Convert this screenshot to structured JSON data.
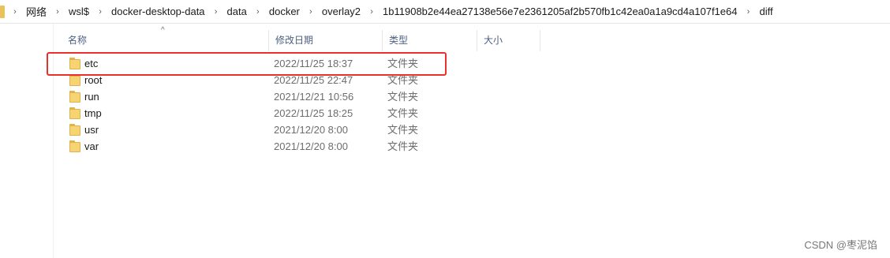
{
  "breadcrumb": {
    "items": [
      "网络",
      "wsl$",
      "docker-desktop-data",
      "data",
      "docker",
      "overlay2",
      "1b11908b2e44ea27138e56e7e2361205af2b570fb1c42ea0a1a9cd4a107f1e64",
      "diff"
    ],
    "separator": "›"
  },
  "columns": {
    "name": "名称",
    "date_modified": "修改日期",
    "type": "类型",
    "size": "大小",
    "sort_indicator": "^"
  },
  "files": [
    {
      "name": "etc",
      "date": "2022/11/25 18:37",
      "type": "文件夹",
      "highlighted": true
    },
    {
      "name": "root",
      "date": "2022/11/25 22:47",
      "type": "文件夹"
    },
    {
      "name": "run",
      "date": "2021/12/21 10:56",
      "type": "文件夹"
    },
    {
      "name": "tmp",
      "date": "2022/11/25 18:25",
      "type": "文件夹"
    },
    {
      "name": "usr",
      "date": "2021/12/20 8:00",
      "type": "文件夹"
    },
    {
      "name": "var",
      "date": "2021/12/20 8:00",
      "type": "文件夹"
    }
  ],
  "watermark": "CSDN @枣泥馅",
  "colors": {
    "highlight": "#e8322b",
    "folder": "#f6d373",
    "header_text": "#4d6082"
  }
}
